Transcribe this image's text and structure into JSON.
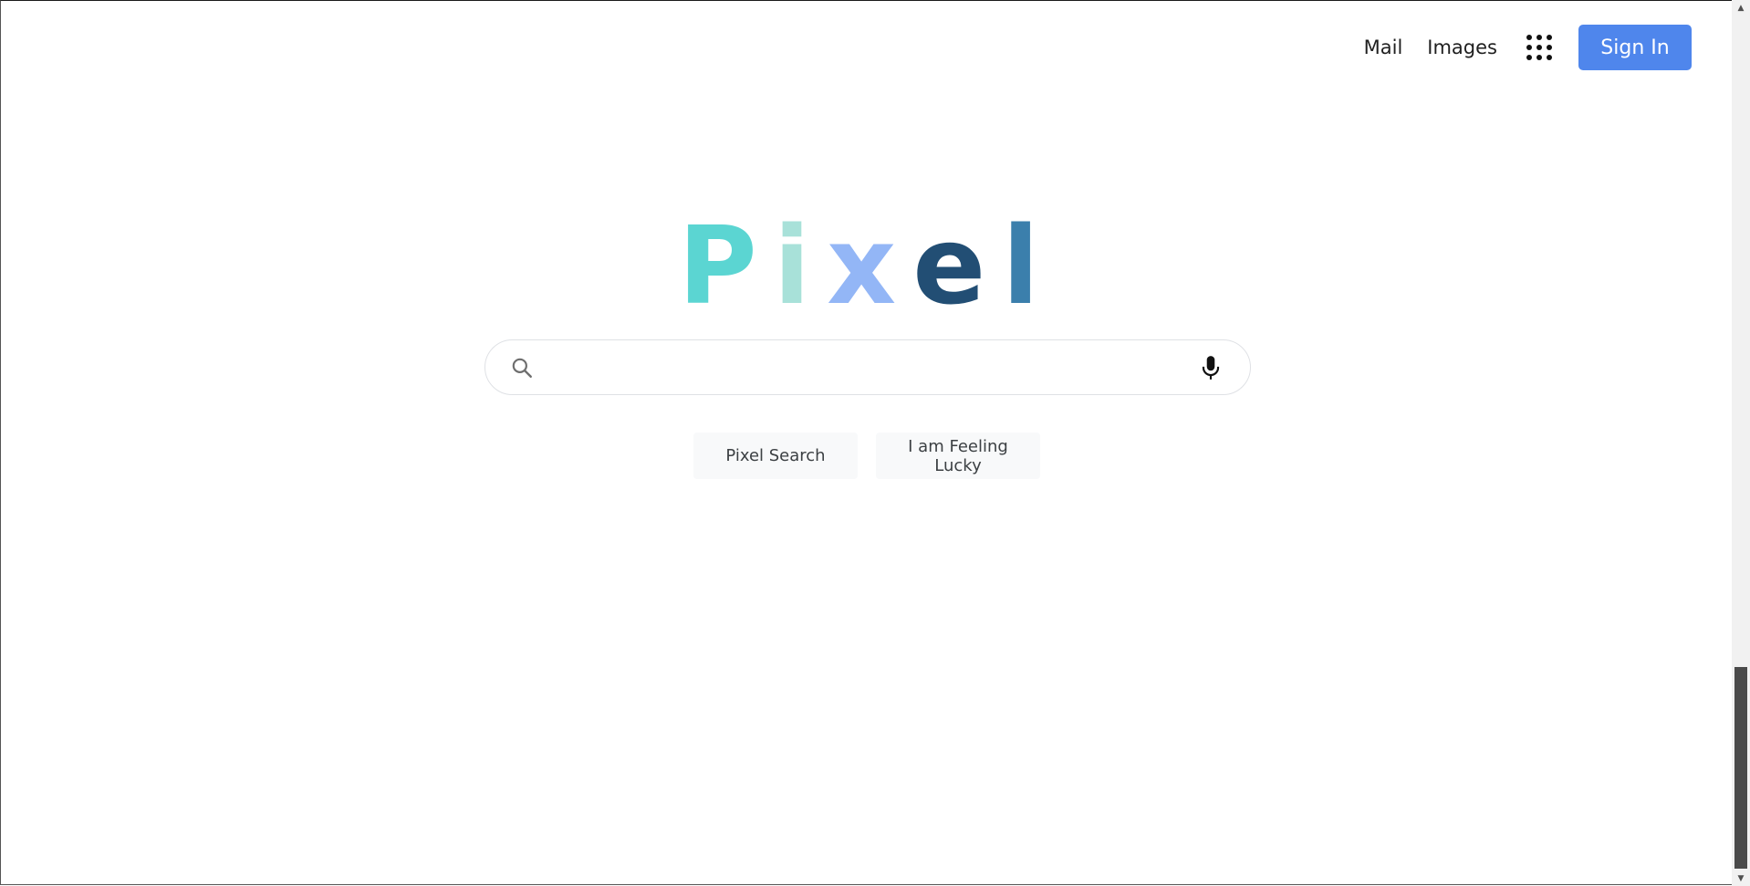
{
  "header": {
    "mail_label": "Mail",
    "images_label": "Images",
    "apps_icon": "apps-grid-icon",
    "signin_label": "Sign In",
    "signin_color": "#4f86ec"
  },
  "logo": {
    "letters": [
      {
        "char": "P",
        "color": "#5bd5d2"
      },
      {
        "char": "i",
        "color": "#a8e1d9"
      },
      {
        "char": "x",
        "color": "#93b6f6"
      },
      {
        "char": "e",
        "color": "#224e74"
      },
      {
        "char": "l",
        "color": "#3b7fac"
      }
    ]
  },
  "search": {
    "value": "",
    "placeholder": "",
    "search_icon": "search-icon",
    "mic_icon": "microphone-icon"
  },
  "buttons": {
    "search_label": "Pixel Search",
    "lucky_label": "I am Feeling Lucky"
  }
}
